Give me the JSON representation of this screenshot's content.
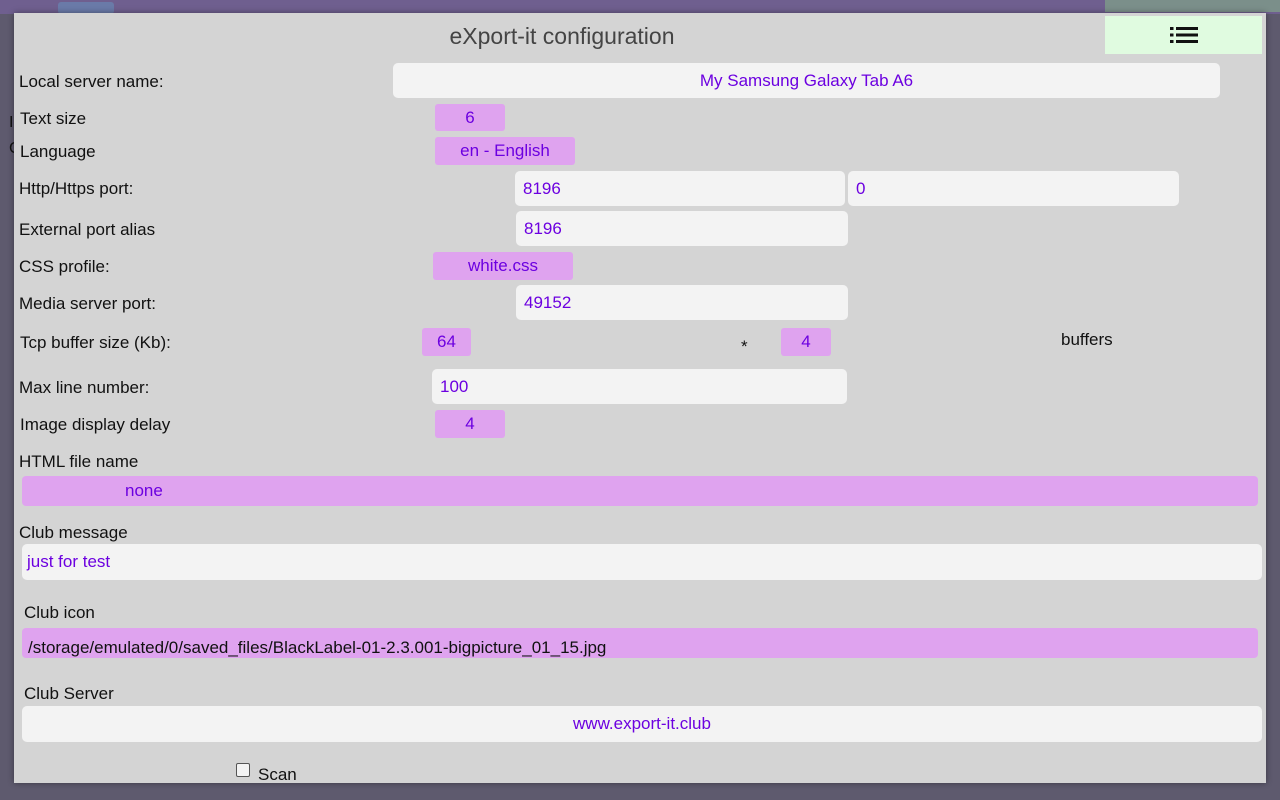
{
  "dialog": {
    "title": "eXport-it configuration",
    "menu_icon": "list-menu-icon"
  },
  "background": {
    "glyph_1": "I",
    "glyph_2": "C"
  },
  "labels": {
    "local_server_name": "Local server name:",
    "text_size": "Text size",
    "language": "Language",
    "http_port": "Http/Https port:",
    "external_port_alias": "External port alias",
    "css_profile": "CSS profile:",
    "media_server_port": "Media server port:",
    "tcp_buffer_size": "Tcp buffer size (Kb):",
    "multiply": "*",
    "buffers": "buffers",
    "max_line_number": "Max line number:",
    "image_display_delay": "Image display delay",
    "html_file_name": "HTML file name",
    "club_message": "Club message",
    "club_icon": "Club icon",
    "club_server": "Club Server",
    "scan": "Scan"
  },
  "values": {
    "local_server_name": "My Samsung Galaxy Tab A6",
    "text_size": "6",
    "language": "en - English",
    "http_port": "8196",
    "https_port": "0",
    "external_port_alias": "8196",
    "css_profile": "white.css",
    "media_server_port": "49152",
    "tcp_buffer_size": "64",
    "tcp_buffer_count": "4",
    "max_line_number": "100",
    "image_display_delay": "4",
    "html_file_name": "none",
    "club_message": "just for test",
    "club_icon": "/storage/emulated/0/saved_files/BlackLabel-01-2.3.001-bigpicture_01_15.jpg",
    "club_server": "www.export-it.club",
    "scan_checked": false
  },
  "colors": {
    "dialog_bg": "#d4d4d4",
    "field_bg": "#f3f3f3",
    "chip_bg": "#dfa3ef",
    "value_text": "#6c00e0",
    "menu_button_bg": "#e0fbe0"
  }
}
